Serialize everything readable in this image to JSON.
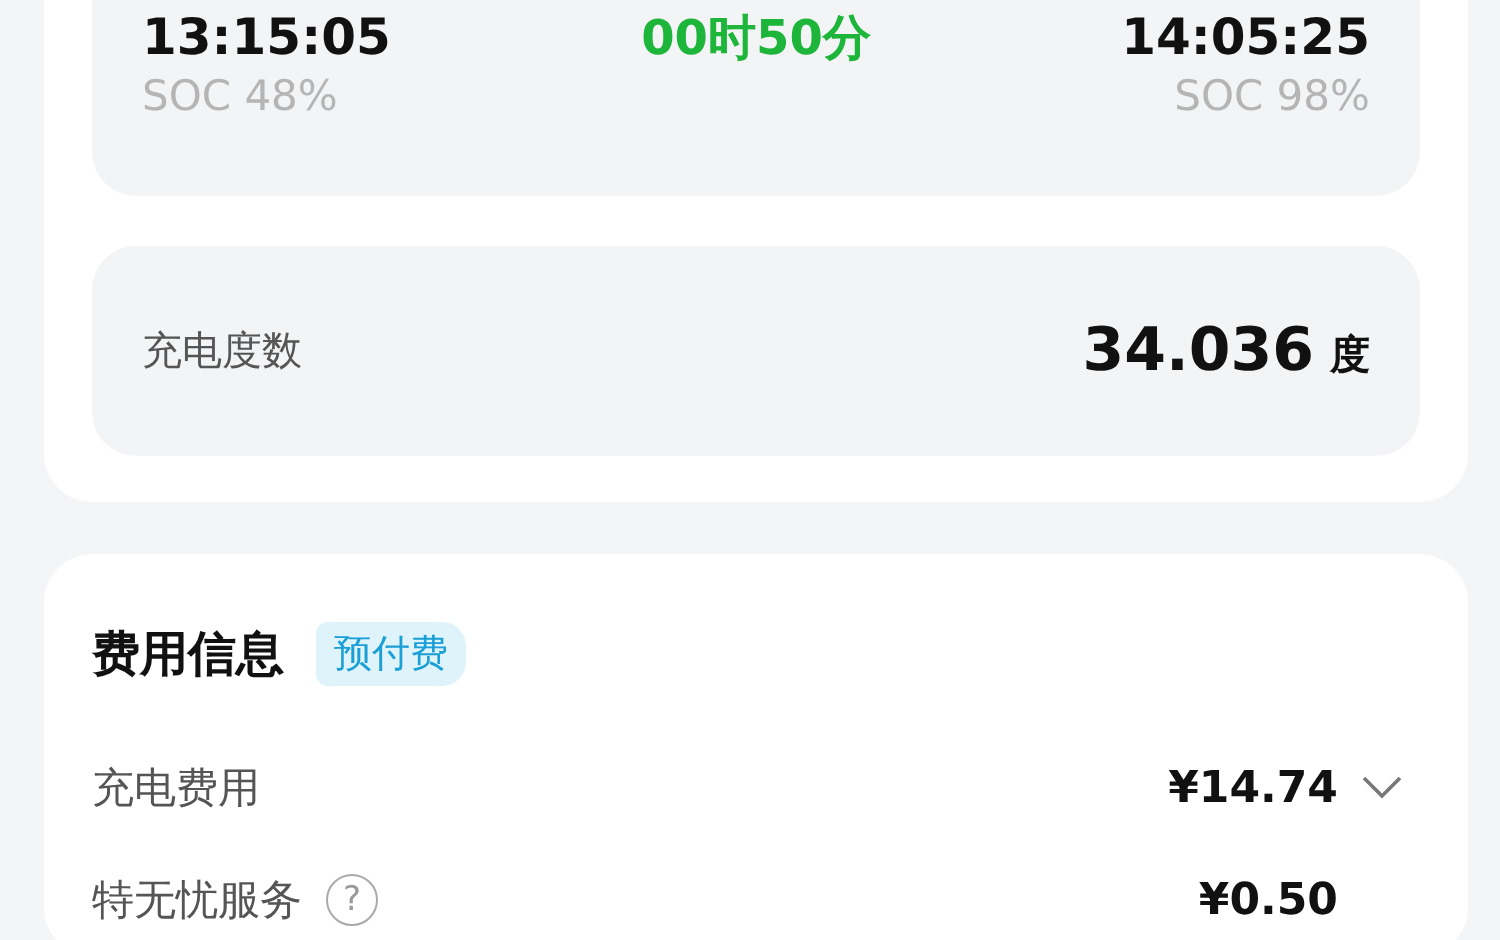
{
  "session": {
    "start": {
      "time": "13:15:05",
      "soc": "SOC 48%"
    },
    "duration": "00时50分",
    "end": {
      "time": "14:05:25",
      "soc": "SOC 98%"
    }
  },
  "energy": {
    "label": "充电度数",
    "value": "34.036",
    "unit": "度"
  },
  "fees": {
    "title": "费用信息",
    "tag": "预付费",
    "rows": [
      {
        "label": "充电费用",
        "value": "¥14.74",
        "kind": "expandable",
        "expanded": false
      },
      {
        "label": "特无忧服务",
        "value": "¥0.50",
        "kind": "help",
        "help": "?"
      }
    ]
  }
}
